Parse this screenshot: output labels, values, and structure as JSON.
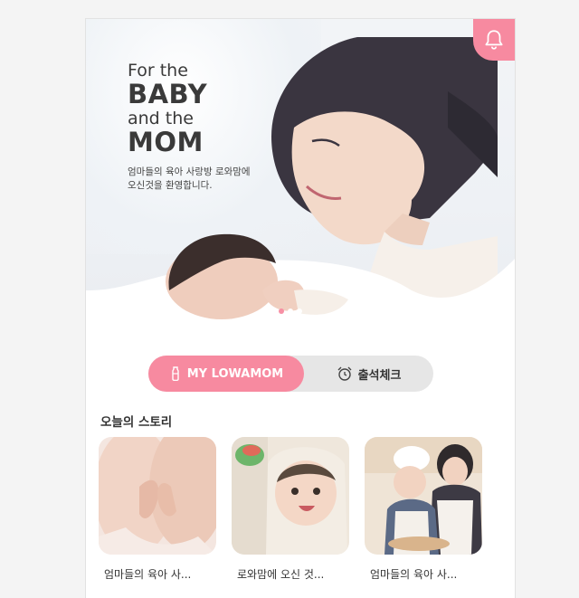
{
  "hero": {
    "line1": "For the",
    "line2": "BABY",
    "line3": "and the",
    "line4": "MOM",
    "desc_line1": "엄마들의 육아 사랑방 로와맘에",
    "desc_line2": "오신것을 환영합니다.",
    "slides": 3,
    "active_slide": 1
  },
  "tabs": {
    "my_label": "MY LOWAMOM",
    "attendance_label": "출석체크"
  },
  "stories": {
    "title": "오늘의 스토리",
    "items": [
      {
        "caption": "엄마들의 육아 사..."
      },
      {
        "caption": "로와맘에 오신 것..."
      },
      {
        "caption": "엄마들의 육아 사..."
      }
    ]
  },
  "colors": {
    "accent": "#f78aa0",
    "tab_bg": "#e6e6e6"
  },
  "icons": {
    "notification": "bell-icon",
    "my": "baby-bottle-icon",
    "attendance": "alarm-clock-icon"
  }
}
